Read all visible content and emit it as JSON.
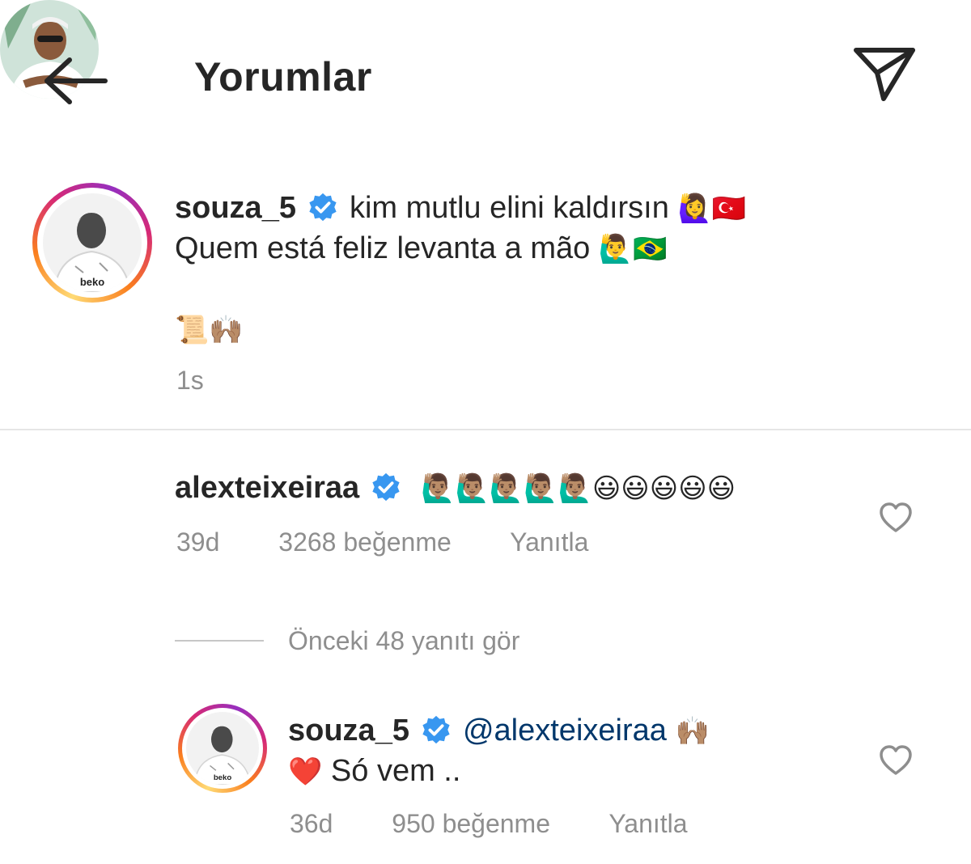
{
  "header": {
    "title": "Yorumlar",
    "back_icon": "arrow-left-icon",
    "send_icon": "paper-plane-icon"
  },
  "caption": {
    "username": "souza_5",
    "line1_text": "kim mutlu elini kaldırsın",
    "line1_emojis": "🙋‍♀️🇹🇷",
    "line2_text": "Quem está feliz levanta a mão",
    "line2_emojis": "🙋‍♂️🇧🇷",
    "line3_emojis": "📜🙌🏽",
    "time": "1s"
  },
  "comment": {
    "username": "alexteixeiraa",
    "emojis": "🙋🏽‍♂️🙋🏽‍♂️🙋🏽‍♂️🙋🏽‍♂️🙋🏽‍♂️😃😃😃😃😃",
    "time": "39d",
    "likes": "3268 beğenme",
    "reply_label": "Yanıtla"
  },
  "view_replies": {
    "label": "Önceki 48 yanıtı gör"
  },
  "reply": {
    "username": "souza_5",
    "mention": "@alexteixeiraa",
    "mention_emoji": "🙌🏽",
    "heart_emoji": "❤️",
    "text": "Só vem ..",
    "time": "36d",
    "likes": "950 beğenme",
    "reply_label": "Yanıtla"
  },
  "colors": {
    "text": "#262626",
    "secondary": "#8e8e8e",
    "verified": "#3897f0",
    "mention": "#00376b",
    "divider": "#e6e6e6"
  }
}
